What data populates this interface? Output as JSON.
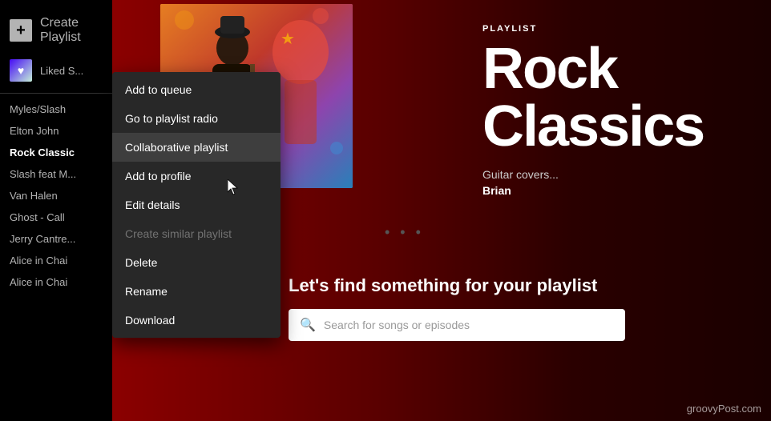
{
  "sidebar": {
    "create_playlist_label": "Create Playlist",
    "liked_songs_label": "Liked S...",
    "items": [
      {
        "id": "myles-slash",
        "label": "Myles/Slash"
      },
      {
        "id": "elton-john",
        "label": "Elton John"
      },
      {
        "id": "rock-classics",
        "label": "Rock Classic",
        "active": true
      },
      {
        "id": "slash-feat",
        "label": "Slash feat M..."
      },
      {
        "id": "van-halen",
        "label": "Van Halen"
      },
      {
        "id": "ghost-call",
        "label": "Ghost - Call"
      },
      {
        "id": "jerry-cantre",
        "label": "Jerry Cantre..."
      },
      {
        "id": "alice-in-chai-1",
        "label": "Alice in Chai"
      },
      {
        "id": "alice-in-chai-2",
        "label": "Alice in Chai"
      }
    ]
  },
  "context_menu": {
    "items": [
      {
        "id": "add-to-queue",
        "label": "Add to queue",
        "disabled": false
      },
      {
        "id": "go-to-playlist-radio",
        "label": "Go to playlist radio",
        "disabled": false
      },
      {
        "id": "collaborative-playlist",
        "label": "Collaborative playlist",
        "disabled": false,
        "active": true
      },
      {
        "id": "add-to-profile",
        "label": "Add to profile",
        "disabled": false
      },
      {
        "id": "edit-details",
        "label": "Edit details",
        "disabled": false
      },
      {
        "id": "create-similar-playlist",
        "label": "Create similar playlist",
        "disabled": true
      },
      {
        "id": "delete",
        "label": "Delete",
        "disabled": false
      },
      {
        "id": "rename",
        "label": "Rename",
        "disabled": false
      },
      {
        "id": "download",
        "label": "Download",
        "disabled": false
      }
    ]
  },
  "main": {
    "playlist_label": "PLAYLIST",
    "playlist_title": "Rock Classics",
    "playlist_desc": "Guitar covers...",
    "playlist_owner": "Brian",
    "find_title": "Let's find something for your playlist",
    "search_placeholder": "Search for songs or episodes"
  },
  "watermark": "groovyPost.com"
}
